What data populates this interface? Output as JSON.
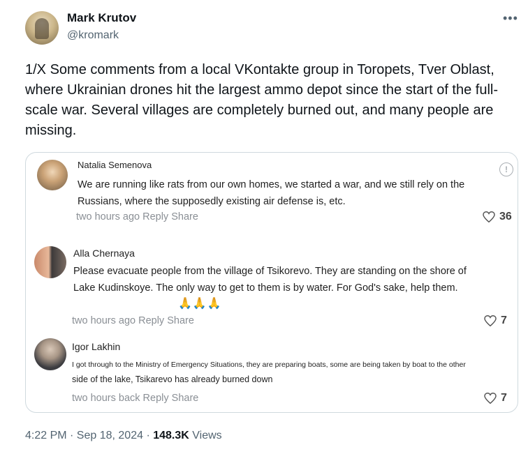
{
  "author": {
    "name": "Mark Krutov",
    "handle": "@kromark"
  },
  "tweet": {
    "text": "1/X Some comments from a local VKontakte group in Toropets, Tver Oblast, where Ukrainian drones hit the largest ammo depot since the start of the full-scale war. Several villages are completely burned out, and many people are missing."
  },
  "embedded": {
    "comments": [
      {
        "name": "Natalia Semenova",
        "lines": [
          "We are running like rats from our own homes, we started a war, and we still rely on the",
          "Russians, where the supposedly existing air defense is, etc."
        ],
        "meta": "two hours ago Reply Share",
        "likes": "36"
      },
      {
        "name": "Alla Chernaya",
        "lines": [
          "Please evacuate people from the village of Tsikorevo. They are standing on the shore of",
          "Lake Kudinskoye. The only way to get to them is by water. For God's sake, help them."
        ],
        "emoji": "🙏🙏🙏",
        "meta": "two hours ago Reply Share",
        "likes": "7"
      },
      {
        "name": "Igor Lakhin",
        "lines": [
          "I got through to the Ministry of Emergency Situations, they are preparing boats, some are being taken by boat to the other",
          "side of the lake, Tsikarevo has already burned down"
        ],
        "meta": "two hours  back Reply Share",
        "likes": "7"
      }
    ]
  },
  "footer": {
    "time": "4:22 PM · Sep 18, 2024 · ",
    "views_count": "148.3K",
    "views_label": " Views"
  },
  "icons": {
    "more": "more-icon",
    "info": "info-icon",
    "heart": "heart-icon"
  }
}
